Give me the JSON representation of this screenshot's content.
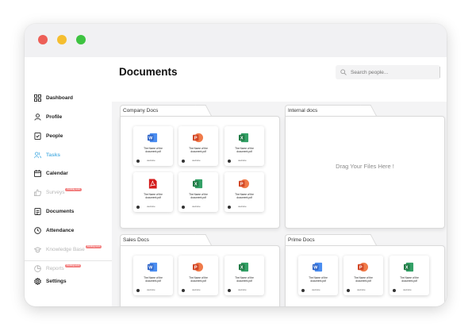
{
  "sidebar": {
    "items": [
      {
        "label": "Dashboard",
        "icon": "grid-icon",
        "state": "normal"
      },
      {
        "label": "Profile",
        "icon": "user-icon",
        "state": "normal"
      },
      {
        "label": "People",
        "icon": "checklist-icon",
        "state": "normal"
      },
      {
        "label": "Tasks",
        "icon": "users-icon",
        "state": "active"
      },
      {
        "label": "Calendar",
        "icon": "calendar-icon",
        "state": "normal"
      },
      {
        "label": "Surveys",
        "icon": "thumbs-up-icon",
        "state": "disabled",
        "badge": "Coming soon"
      },
      {
        "label": "Documents",
        "icon": "document-icon",
        "state": "normal"
      },
      {
        "label": "Attendance",
        "icon": "clock-icon",
        "state": "normal"
      },
      {
        "label": "Knowledge Base",
        "icon": "graduation-cap-icon",
        "state": "disabled",
        "badge": "Coming soon"
      },
      {
        "label": "Reports",
        "icon": "pie-chart-icon",
        "state": "disabled",
        "badge": "Coming soon"
      }
    ],
    "settings_label": "Settings"
  },
  "header": {
    "title": "Documents",
    "search_placeholder": "Search people..."
  },
  "folders": {
    "company": {
      "title": "Company Docs",
      "files": [
        {
          "type": "word",
          "name": "The Name of the document.pdf",
          "owner": "username"
        },
        {
          "type": "powerpoint",
          "name": "The Name of the document.pdf",
          "owner": "username"
        },
        {
          "type": "excel",
          "name": "The Name of the document.pdf",
          "owner": "username"
        },
        {
          "type": "pdf",
          "name": "The Name of the document.pdf",
          "owner": "username"
        },
        {
          "type": "excel",
          "name": "The Name of the document.pdf",
          "owner": "username"
        },
        {
          "type": "powerpoint",
          "name": "The Name of the document.pdf",
          "owner": "username"
        }
      ]
    },
    "internal": {
      "title": "Internal docs",
      "drop_text": "Drag Your Files Here !"
    },
    "sales": {
      "title": "Sales Docs",
      "files": [
        {
          "type": "word",
          "name": "The Name of the document.pdf",
          "owner": "username"
        },
        {
          "type": "powerpoint",
          "name": "The Name of the document.pdf",
          "owner": "username"
        },
        {
          "type": "excel",
          "name": "The Name of the document.pdf",
          "owner": "username"
        }
      ]
    },
    "prime": {
      "title": "Prime Docs",
      "files": [
        {
          "type": "word",
          "name": "The Name of the document.pdf",
          "owner": "username"
        },
        {
          "type": "powerpoint",
          "name": "The Name of the document.pdf",
          "owner": "username"
        },
        {
          "type": "excel",
          "name": "The Name of the document.pdf",
          "owner": "username"
        }
      ]
    }
  },
  "colors": {
    "accent": "#5fb6e5",
    "word": "#2b62c7",
    "powerpoint": "#d24726",
    "excel": "#1f7a45",
    "pdf": "#d41c1c",
    "badge": "#f27f7f"
  }
}
